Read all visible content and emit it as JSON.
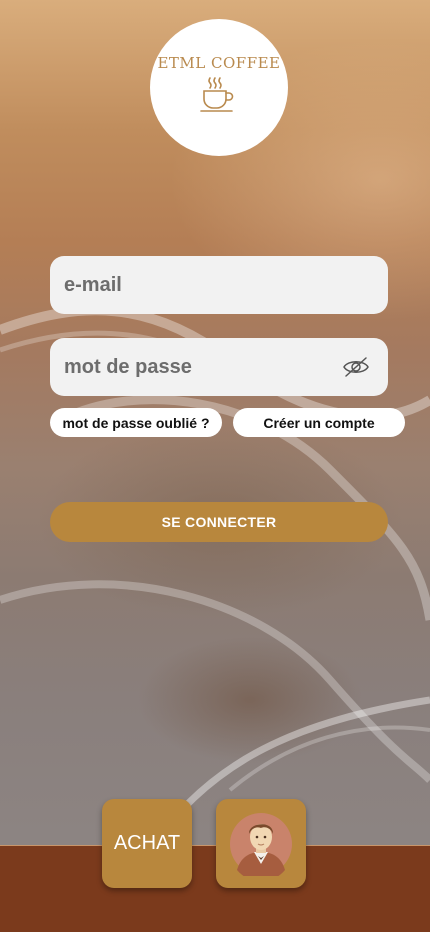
{
  "brand": {
    "name": "ETML COFFEE",
    "logo_icon": "coffee-cup-icon",
    "accent_color": "#b8873d",
    "bar_color": "#7b3a1c"
  },
  "login": {
    "email_placeholder": "e-mail",
    "password_placeholder": "mot de passe",
    "password_toggle_icon": "eye-slash-icon",
    "forgot_label": "mot de passe oublié ?",
    "create_label": "Créer un compte",
    "connect_label": "SE CONNECTER"
  },
  "nav": {
    "achat_label": "ACHAT",
    "profile_icon": "avatar-icon"
  }
}
